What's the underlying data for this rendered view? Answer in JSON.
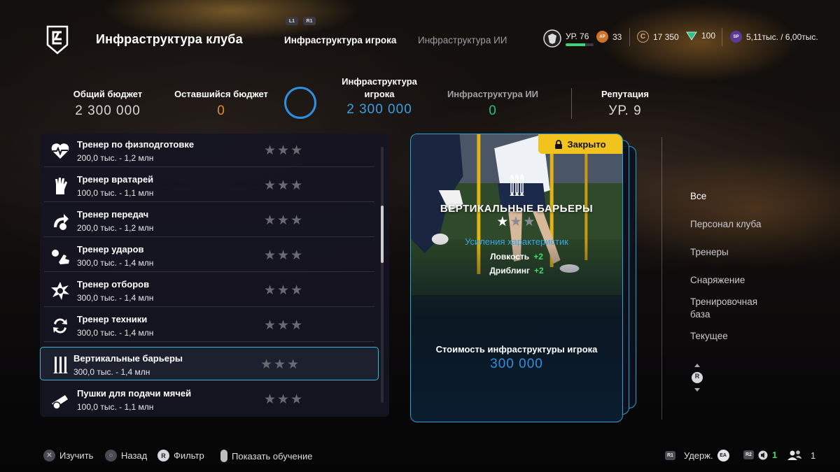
{
  "header": {
    "title": "Инфраструктура клуба",
    "tab_buttons": [
      "L1",
      "R1"
    ],
    "tabs": [
      {
        "label": "Инфраструктура игрока",
        "active": true
      },
      {
        "label": "Инфраструктура ИИ",
        "active": false
      }
    ],
    "level": {
      "label": "УР. 76",
      "progress_fraction": 0.7
    },
    "ap": {
      "label": "AP",
      "value": "33"
    },
    "coins": {
      "label": "C",
      "value": "17 350"
    },
    "points": {
      "value": "100"
    },
    "sp": {
      "label": "SP",
      "value": "5,11тыс. / 6,00тыс."
    }
  },
  "budget": {
    "total": {
      "label": "Общий бюджет",
      "value": "2 300 000"
    },
    "remaining": {
      "label": "Оставшийся бюджет",
      "value": "0"
    },
    "player": {
      "label_line1": "Инфраструктура",
      "label_line2": "игрока",
      "value": "2 300 000"
    },
    "ai": {
      "label": "Инфраструктура ИИ",
      "value": "0"
    },
    "reputation": {
      "label": "Репутация",
      "value": "УР. 9"
    }
  },
  "list": {
    "items": [
      {
        "name": "Тренер по физподготовке",
        "price": "200,0 тыс. - 1,2 млн",
        "icon": "heart-pulse-icon",
        "stars": 0
      },
      {
        "name": "Тренер вратарей",
        "price": "100,0 тыс. - 1,1 млн",
        "icon": "glove-icon",
        "stars": 0
      },
      {
        "name": "Тренер передач",
        "price": "200,0 тыс. - 1,2 млн",
        "icon": "pass-arrow-icon",
        "stars": 0
      },
      {
        "name": "Тренер ударов",
        "price": "300,0 тыс. - 1,4 млн",
        "icon": "boot-kick-icon",
        "stars": 0
      },
      {
        "name": "Тренер отборов",
        "price": "300,0 тыс. - 1,4 млн",
        "icon": "tackle-burst-icon",
        "stars": 0
      },
      {
        "name": "Тренер техники",
        "price": "300,0 тыс. - 1,4 млн",
        "icon": "technique-cycle-icon",
        "stars": 0
      },
      {
        "name": "Вертикальные барьеры",
        "price": "300,0 тыс. - 1,4 млн",
        "icon": "vertical-poles-icon",
        "stars": 0,
        "selected": true
      },
      {
        "name": "Пушки для подачи мячей",
        "price": "100,0 тыс. - 1,1 млн",
        "icon": "ball-cannon-icon",
        "stars": 0
      }
    ],
    "star_glyph": "★★★"
  },
  "card": {
    "locked_label": "Закрыто",
    "title": "ВЕРТИКАЛЬНЫЕ БАРЬЕРЫ",
    "stars_filled": 1,
    "stars_total": 3,
    "boost_label": "Усиления характеристик",
    "boosts": [
      {
        "name": "Ловкость",
        "value": "+2"
      },
      {
        "name": "Дриблинг",
        "value": "+2"
      }
    ],
    "cost_label": "Стоимость инфраструктуры игрока",
    "cost_value": "300 000"
  },
  "filter_menu": {
    "items": [
      {
        "label": "Все",
        "active": true
      },
      {
        "label": "Персонал клуба",
        "active": false
      },
      {
        "label": "Тренеры",
        "active": false
      },
      {
        "label": "Снаряжение",
        "active": false
      },
      {
        "label": "Тренировочная база",
        "active": false
      },
      {
        "label": "Текущее",
        "active": false
      }
    ],
    "nav_button": "R"
  },
  "footer": {
    "actions": [
      {
        "button": "cross",
        "label": "Изучить"
      },
      {
        "button": "circle",
        "label": "Назад"
      },
      {
        "button": "R",
        "label": "Фильтр"
      },
      {
        "button": "touchpad",
        "label": "Показать обучение"
      }
    ],
    "hold": {
      "button": "R1",
      "label": "Удерж.",
      "badge": "EA"
    },
    "r2": {
      "button": "R2",
      "value": "1"
    },
    "friends": {
      "value": "1"
    }
  },
  "colors": {
    "accent_blue": "#2f8fe0",
    "accent_cyan": "#2aa6d4",
    "orange": "#e38a2a",
    "locked_yellow": "#f2c21d",
    "plus_green": "#3fdc6a"
  }
}
